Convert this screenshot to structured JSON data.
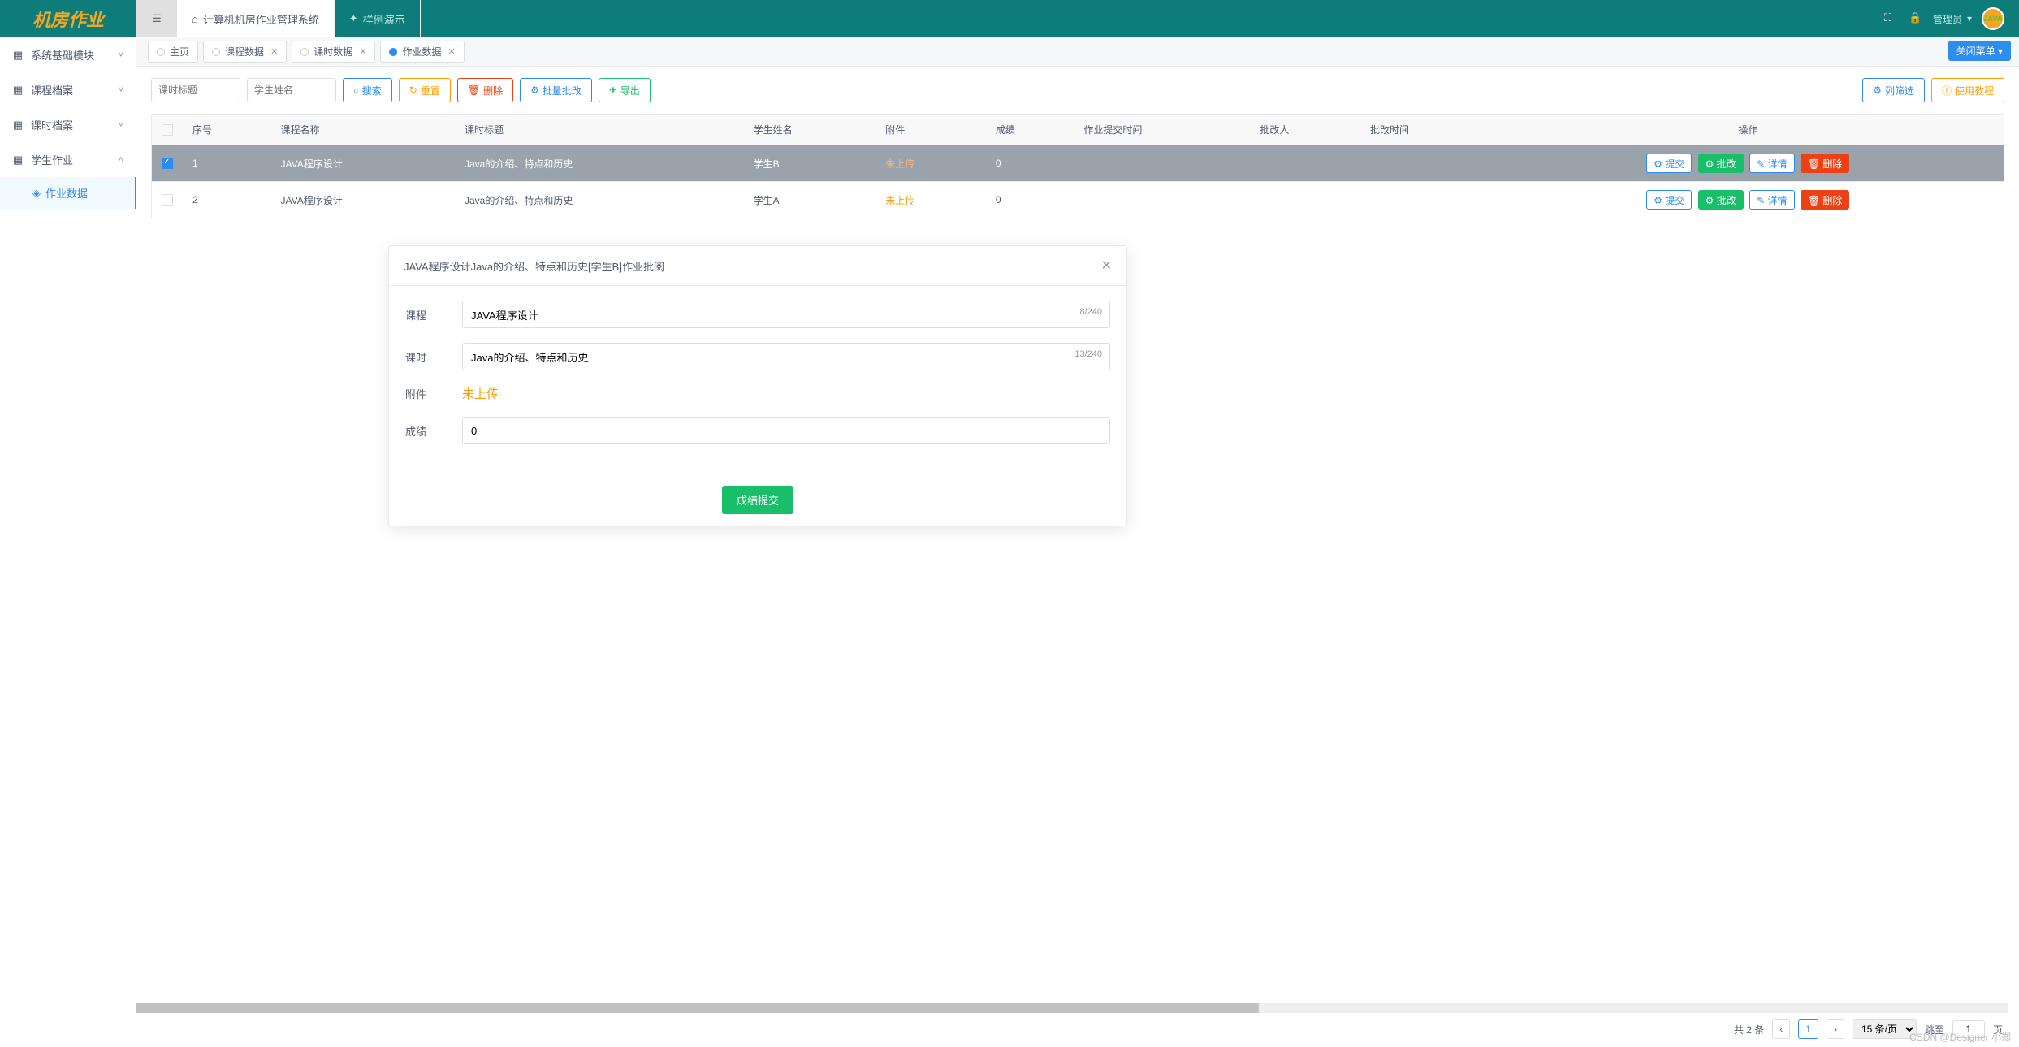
{
  "logo": "机房作业",
  "sidemenu": [
    {
      "icon": "▦",
      "label": "系统基础模块",
      "expand": "down"
    },
    {
      "icon": "▦",
      "label": "课程档案",
      "expand": "down"
    },
    {
      "icon": "▦",
      "label": "课时档案",
      "expand": "down"
    },
    {
      "icon": "▦",
      "label": "学生作业",
      "expand": "up",
      "children": [
        {
          "icon": "◈",
          "label": "作业数据",
          "active": true
        }
      ]
    }
  ],
  "toptabs": [
    {
      "icon": "⌂",
      "label": "计算机机房作业管理系统",
      "active": true
    },
    {
      "icon": "✦",
      "label": "样例演示",
      "active": false
    }
  ],
  "topright": {
    "user_label": "管理员",
    "avatar_text": "JAVA"
  },
  "pagetabs": [
    {
      "label": "主页",
      "closable": false
    },
    {
      "label": "课程数据",
      "closable": true
    },
    {
      "label": "课时数据",
      "closable": true
    },
    {
      "label": "作业数据",
      "closable": true,
      "active": true
    }
  ],
  "close_all": "关闭菜单 ▾",
  "filters": {
    "lesson_placeholder": "课时标题",
    "student_placeholder": "学生姓名"
  },
  "buttons": {
    "search": "搜索",
    "reset": "重置",
    "delete": "删除",
    "batch_edit": "批量批改",
    "export": "导出",
    "col_filter": "列筛选",
    "tutorial": "使用教程"
  },
  "table": {
    "headers": [
      "序号",
      "课程名称",
      "课时标题",
      "学生姓名",
      "附件",
      "成绩",
      "作业提交时间",
      "批改人",
      "批改时间",
      "操作"
    ],
    "rows": [
      {
        "selected": true,
        "seq": "1",
        "course": "JAVA程序设计",
        "lesson": "Java的介绍、特点和历史",
        "student": "学生B",
        "attach": "未上传",
        "score": "0",
        "submit_time": "",
        "reviewer": "",
        "review_time": ""
      },
      {
        "selected": false,
        "seq": "2",
        "course": "JAVA程序设计",
        "lesson": "Java的介绍、特点和历史",
        "student": "学生A",
        "attach": "未上传",
        "score": "0",
        "submit_time": "",
        "reviewer": "",
        "review_time": ""
      }
    ],
    "ops": {
      "submit": "提交",
      "edit": "批改",
      "detail": "详情",
      "delete": "删除"
    }
  },
  "modal": {
    "title": "JAVA程序设计Java的介绍、特点和历史[学生B]作业批阅",
    "course_label": "课程",
    "course_value": "JAVA程序设计",
    "course_counter": "8/240",
    "lesson_label": "课时",
    "lesson_value": "Java的介绍、特点和历史",
    "lesson_counter": "13/240",
    "attach_label": "附件",
    "attach_value": "未上传",
    "score_label": "成绩",
    "score_value": "0",
    "submit": "成绩提交"
  },
  "pager": {
    "total": "共 2 条",
    "page": "1",
    "size_label": "15 条/页",
    "jump_label": "跳至",
    "jump_value": "1",
    "page_suffix": "页"
  },
  "watermark": "CSDN @Designer 小郑"
}
